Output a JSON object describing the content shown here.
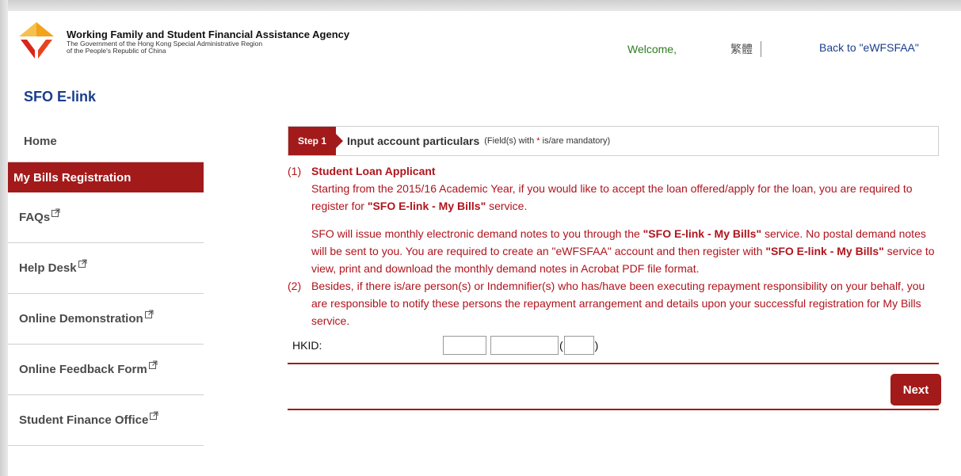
{
  "header": {
    "agency_name": "Working Family and Student Financial Assistance Agency",
    "agency_sub1": "The Government of the Hong Kong Special Administrative Region",
    "agency_sub2": "of the People's Republic of China",
    "welcome": "Welcome,",
    "language_link": "繁體",
    "back_link": "Back to \"eWFSFAA\""
  },
  "site_title": "SFO E-link",
  "sidebar": {
    "items": [
      {
        "label": "Home",
        "external": false
      },
      {
        "label": "My Bills Registration",
        "external": false,
        "active": true
      },
      {
        "label": "FAQs",
        "external": true
      },
      {
        "label": "Help Desk",
        "external": true
      },
      {
        "label": "Online Demonstration",
        "external": true
      },
      {
        "label": "Online Feedback Form",
        "external": true
      },
      {
        "label": "Student Finance Office",
        "external": true
      }
    ]
  },
  "step": {
    "badge": "Step 1",
    "title": "Input account particulars",
    "note_pre": "(Field(s) with",
    "note_star": "*",
    "note_post": "is/are mandatory)"
  },
  "content": {
    "item1_num": "(1)",
    "item1_heading": "Student Loan Applicant",
    "item1_p1_pre": "Starting from the 2015/16 Academic Year, if you would like to accept the loan offered/apply for the loan, you are required to register for ",
    "item1_p1_bold": "\"SFO E-link - My Bills\"",
    "item1_p1_post": " service.",
    "item1_p2_pre": "SFO will issue monthly electronic demand notes to you through the ",
    "item1_p2_bold1": "\"SFO E-link - My Bills\"",
    "item1_p2_mid": " service. No postal demand notes will be sent to you. You are required to create an \"eWFSFAA\" account and then register with ",
    "item1_p2_bold2": "\"SFO E-link - My Bills\"",
    "item1_p2_post": " service to view, print and download the monthly demand notes in Acrobat PDF file format.",
    "item2_num": "(2)",
    "item2_text": "Besides, if there is/are person(s) or Indemnifier(s) who has/have been executing repayment responsibility on your behalf, you are responsible to notify these persons the repayment arrangement and details upon your successful registration for My Bills service."
  },
  "form": {
    "hkid_label": "HKID:",
    "hkid_prefix_value": "",
    "hkid_digits_value": "",
    "hkid_check_value": "",
    "paren_open": "(",
    "paren_close": ")",
    "next_label": "Next"
  },
  "colors": {
    "brand_red": "#a31a1a",
    "text_red": "#b0141d",
    "title_blue": "#1a3e8c",
    "welcome_green": "#2d7d1f"
  }
}
